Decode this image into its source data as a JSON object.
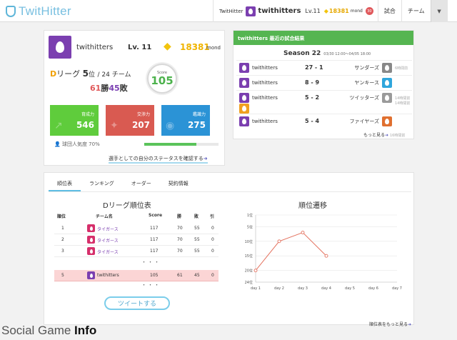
{
  "header": {
    "logo": "TwitHitter",
    "site_label": "TwitHitter",
    "user": "twithitters",
    "level": "Lv.11",
    "gold": "18381",
    "gold_unit": "mond",
    "badge": "30",
    "nav_match": "試合",
    "nav_team": "チーム",
    "dropdown": "▼"
  },
  "profile": {
    "name": "twithitters",
    "level": "Lv. 11",
    "gold": "18381",
    "gold_unit": "mond",
    "league_letter": "D",
    "league_word": "リーグ",
    "rank": "5",
    "rank_unit": "位",
    "rank_total": "/ 24 チーム",
    "wins": "61",
    "wins_unit": "勝",
    "losses": "45",
    "losses_unit": "敗",
    "score_label": "Score",
    "score": "105",
    "stats": [
      {
        "label": "育成力",
        "value": "546",
        "color": "#5fcc3c"
      },
      {
        "label": "交渉力",
        "value": "207",
        "color": "#d95a51"
      },
      {
        "label": "鑑識力",
        "value": "275",
        "color": "#2b93d6"
      }
    ],
    "popularity_label": "球団人気度 70%",
    "popularity": 0.7,
    "status_link": "選手としての自分のステータスを確認する"
  },
  "results": {
    "title": "twithitters 最近の試合結果",
    "season": "Season 22",
    "season_range": "03/30 12:00〜04/05 18:00",
    "rows": [
      {
        "me": "twithitters",
        "score": "27 - 1",
        "opponent": "サンダーズ",
        "status": "6時間前",
        "color": "#888888"
      },
      {
        "me": "twithitters",
        "score": "8 - 9",
        "opponent": "ヤンキース",
        "status": "",
        "color": "#2fa6dc"
      },
      {
        "me": "twithitters",
        "score": "5 - 2",
        "opponent": "ツイッターズ",
        "status": "14時間前",
        "color": "#9a9a9a"
      },
      {
        "me": "",
        "score": "",
        "opponent": "",
        "status": "14時間前",
        "color": "#f0a020"
      },
      {
        "me": "twithitters",
        "score": "5 - 4",
        "opponent": "ファイヤーズ",
        "status": "",
        "color": "#e07030"
      }
    ],
    "more": "もっと見る",
    "more_status": "16時間前"
  },
  "tabs": [
    "順位表",
    "ランキング",
    "オーダー",
    "契約情報"
  ],
  "standings": {
    "title": "Dリーグ順位表",
    "headers": [
      "順位",
      "チーム名",
      "Score",
      "勝",
      "敗",
      "引"
    ],
    "rows": [
      {
        "rank": "1",
        "team": "タイガース",
        "score": "117",
        "w": "70",
        "l": "55",
        "d": "0",
        "highlight": false
      },
      {
        "rank": "2",
        "team": "タイガース",
        "score": "117",
        "w": "70",
        "l": "55",
        "d": "0",
        "highlight": false
      },
      {
        "rank": "3",
        "team": "タイガース",
        "score": "117",
        "w": "70",
        "l": "55",
        "d": "0",
        "highlight": false
      },
      {
        "rank": "5",
        "team": "twithitters",
        "score": "105",
        "w": "61",
        "l": "45",
        "d": "0",
        "highlight": true
      }
    ],
    "ellipsis": "・・・"
  },
  "tweet_button": "ツイートする",
  "rank_more": "順位表をもっと見る",
  "chart_data": {
    "type": "line",
    "title": "順位遷移",
    "categories": [
      "day 1",
      "day 2",
      "day 3",
      "day 4",
      "day 5",
      "day 6",
      "day 7"
    ],
    "values": [
      20,
      10,
      7,
      15,
      null,
      null,
      null
    ],
    "y_ticks": [
      "1位",
      "5位",
      "10位",
      "15位",
      "20位",
      "24位"
    ],
    "y_tick_values": [
      1,
      5,
      10,
      15,
      20,
      24
    ],
    "ylim": [
      1,
      24
    ],
    "y_inverted": true,
    "grid": true,
    "color": "#e4725f"
  },
  "watermark": {
    "prefix": "Social Game ",
    "suffix": "Info"
  }
}
